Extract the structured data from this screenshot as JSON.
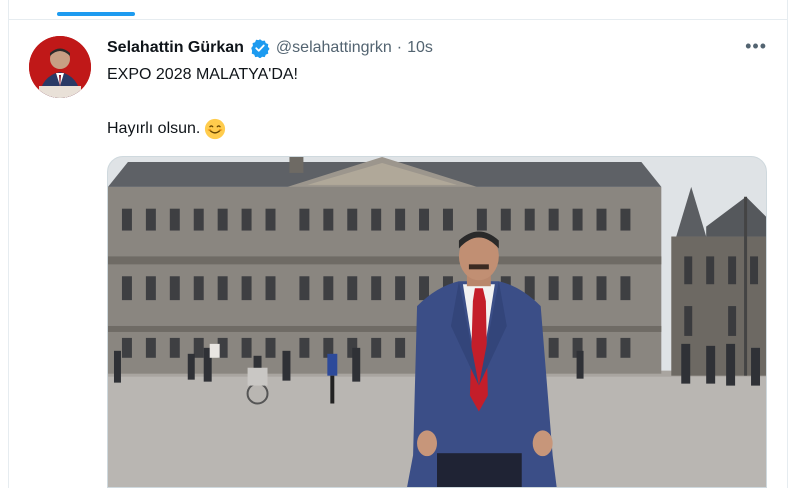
{
  "tweet": {
    "display_name": "Selahattin Gürkan",
    "handle": "@selahattingrkn",
    "separator": "·",
    "timestamp": "10s",
    "more_label": "•••",
    "text_line1": "EXPO 2028 MALATYA'DA!",
    "text_line2": "Hayırlı olsun.",
    "emoji": "smiling-face-icon"
  },
  "colors": {
    "accent": "#1d9bf0",
    "verified": "#1d9bf0",
    "secondary_text": "#536471"
  }
}
